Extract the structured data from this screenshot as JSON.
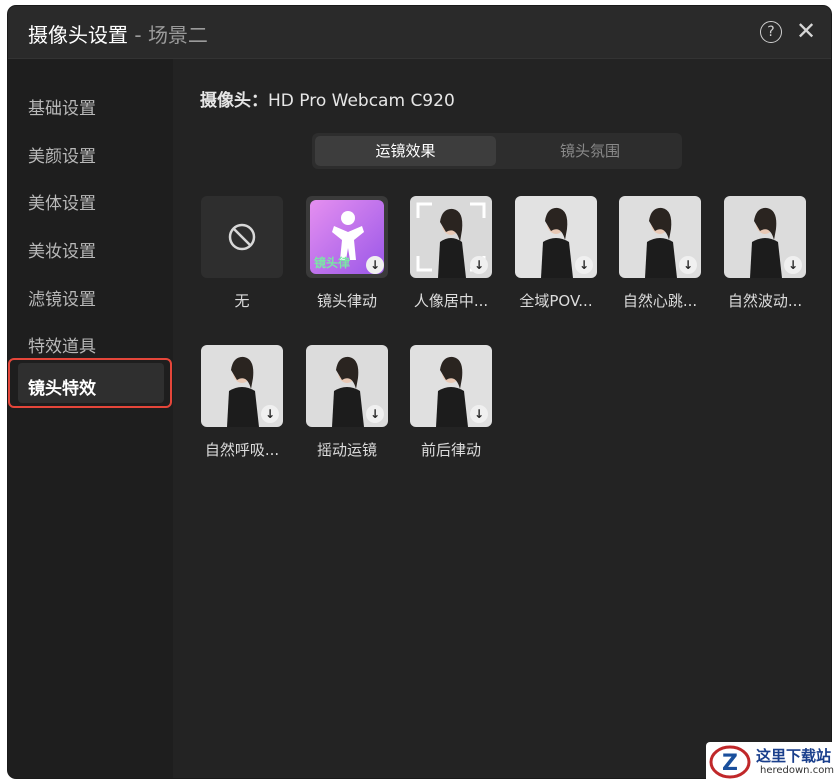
{
  "window": {
    "title": "摄像头设置",
    "title_sep": " - ",
    "title_sub": "场景二",
    "help_glyph": "?",
    "close_glyph": "✕"
  },
  "sidebar": {
    "items": [
      {
        "label": "基础设置"
      },
      {
        "label": "美颜设置"
      },
      {
        "label": "美体设置"
      },
      {
        "label": "美妆设置"
      },
      {
        "label": "滤镜设置"
      },
      {
        "label": "特效道具"
      },
      {
        "label": "镜头特效",
        "active": true
      }
    ]
  },
  "main": {
    "camera_prefix": "摄像头：",
    "camera_name": "HD Pro Webcam C920",
    "tabs": [
      {
        "label": "运镜效果",
        "selected": true
      },
      {
        "label": "镜头氛围",
        "selected": false
      }
    ],
    "effects": [
      {
        "label": "无",
        "icon": "prohibit-icon"
      },
      {
        "label": "镜头律动",
        "badge": "镜头律",
        "downloadable": true
      },
      {
        "label": "人像居中...",
        "downloadable": true
      },
      {
        "label": "全域POV...",
        "downloadable": true
      },
      {
        "label": "自然心跳...",
        "downloadable": true
      },
      {
        "label": "自然波动...",
        "downloadable": true
      },
      {
        "label": "自然呼吸...",
        "downloadable": true
      },
      {
        "label": "摇动运镜",
        "downloadable": true
      },
      {
        "label": "前后律动",
        "downloadable": true
      }
    ]
  },
  "watermark": {
    "logo_letter": "Z",
    "text": "这里下载站",
    "url": "heredown.com"
  },
  "colors": {
    "accent_red": "#e5463a",
    "window_bg": "#232323",
    "sidebar_bg": "#1e1e1e"
  }
}
